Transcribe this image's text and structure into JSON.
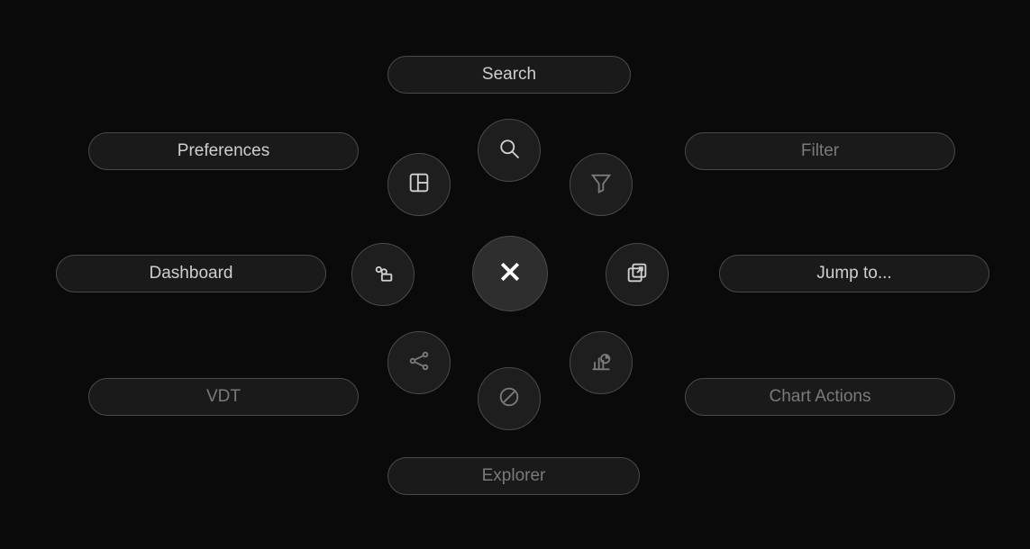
{
  "radialMenu": {
    "center": {
      "icon": "close-icon"
    },
    "items": {
      "search": {
        "label": "Search",
        "icon": "search-icon"
      },
      "preferences": {
        "label": "Preferences",
        "icon": "grid-icon"
      },
      "filter": {
        "label": "Filter",
        "icon": "funnel-icon"
      },
      "dashboard": {
        "label": "Dashboard",
        "icon": "dashboard-icon"
      },
      "jumpto": {
        "label": "Jump to...",
        "icon": "open-external-icon"
      },
      "vdt": {
        "label": "VDT",
        "icon": "share-icon"
      },
      "chartactions": {
        "label": "Chart Actions",
        "icon": "chart-icon"
      },
      "explorer": {
        "label": "Explorer",
        "icon": "compass-icon"
      }
    }
  }
}
